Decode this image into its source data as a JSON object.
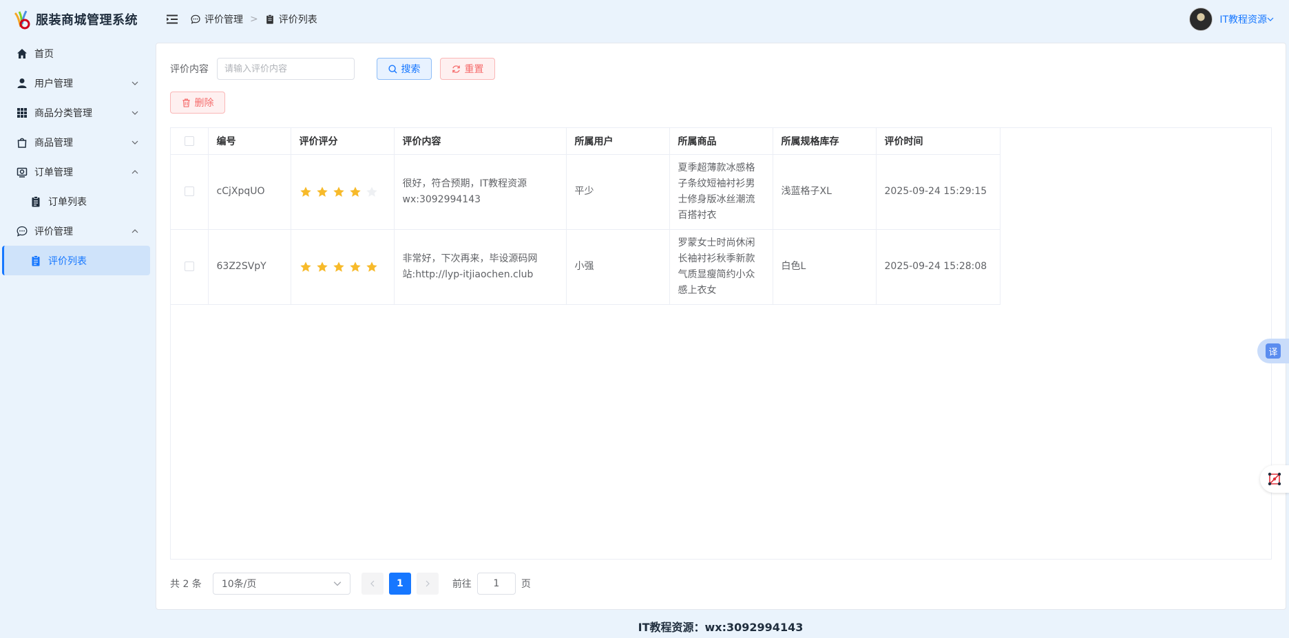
{
  "app": {
    "title": "服装商城管理系统"
  },
  "sidebar": {
    "items": [
      {
        "label": "首页"
      },
      {
        "label": "用户管理"
      },
      {
        "label": "商品分类管理"
      },
      {
        "label": "商品管理"
      },
      {
        "label": "订单管理"
      },
      {
        "label": "订单列表"
      },
      {
        "label": "评价管理"
      },
      {
        "label": "评价列表"
      }
    ]
  },
  "breadcrumb": {
    "parent": "评价管理",
    "current": "评价列表"
  },
  "user": {
    "name": "IT教程资源"
  },
  "search": {
    "label": "评价内容",
    "placeholder": "请输入评价内容",
    "value": "",
    "search_label": "搜索",
    "reset_label": "重置",
    "delete_label": "删除"
  },
  "table": {
    "columns": [
      "编号",
      "评价评分",
      "评价内容",
      "所属用户",
      "所属商品",
      "所属规格库存",
      "评价时间"
    ],
    "rows": [
      {
        "id": "cCjXpqUO",
        "rating": 4,
        "content": "很好，符合预期，IT教程资源wx:3092994143",
        "user": "平少",
        "product": "夏季超薄款冰感格子条纹短袖衬衫男士修身版冰丝潮流百搭衬衣",
        "spec": "浅蓝格子XL",
        "time": "2025-09-24 15:29:15"
      },
      {
        "id": "63Z2SVpY",
        "rating": 5,
        "content": "非常好，下次再来，毕设源码网站:http://lyp-itjiaochen.club",
        "user": "小强",
        "product": "罗蒙女士时尚休闲长袖衬衫秋季新款气质显瘦简约小众感上衣女",
        "spec": "白色L",
        "time": "2025-09-24 15:28:08"
      }
    ]
  },
  "pagination": {
    "total_text": "共 2 条",
    "page_size": "10条/页",
    "current_page": "1",
    "goto_label": "前往",
    "goto_value": "1",
    "page_unit": "页"
  },
  "footer": {
    "text": "IT教程资源：wx:3092994143"
  },
  "float": {
    "translate_label": "译"
  },
  "colors": {
    "accent": "#1677ff",
    "danger": "#f56c6c",
    "star": "#f7ba2a",
    "star_empty": "#eef0f3"
  }
}
